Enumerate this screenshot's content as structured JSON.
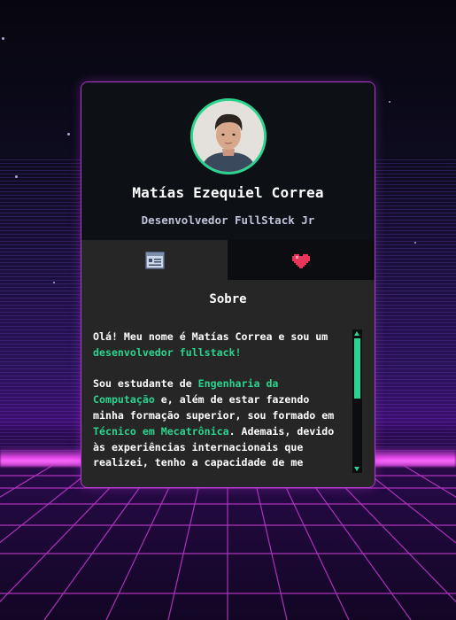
{
  "profile": {
    "name": "Matías Ezequiel Correa",
    "role": "Desenvolvedor FullStack Jr"
  },
  "tabs": [
    {
      "icon": "about-card-icon",
      "active": true
    },
    {
      "icon": "heart-icon",
      "active": false
    }
  ],
  "about": {
    "title": "Sobre",
    "p1_a": "Olá! Meu nome é Matías Correa e sou um ",
    "p1_hl": "desenvolvedor fullstack!",
    "p2_a": "Sou estudante de ",
    "p2_hl1": "Engenharia da Computação",
    "p2_b": " e, além de estar fazendo minha formação superior, sou formado em ",
    "p2_hl2": "Técnico em Mecatrônica",
    "p2_c": ". Ademais, devido às experiências internacionais que realizei, tenho a capacidade de me"
  },
  "colors": {
    "accent": "#2bd48e",
    "border": "#b33ad6",
    "panel": "#262626",
    "dark": "#0d1014"
  }
}
